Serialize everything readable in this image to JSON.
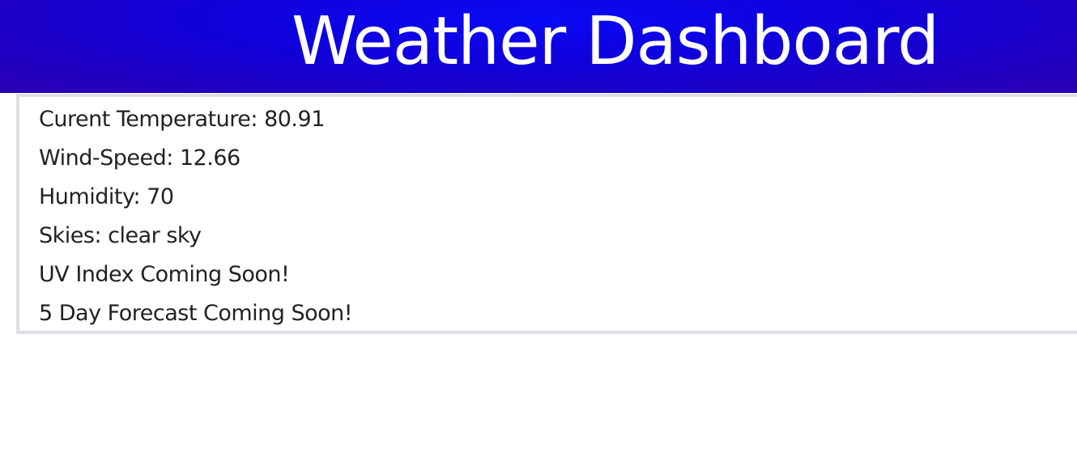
{
  "header": {
    "title": "Weather Dashboard"
  },
  "weather": {
    "items": [
      "Curent Temperature: 80.91",
      "Wind-Speed: 12.66",
      "Humidity: 70",
      "Skies: clear sky",
      "UV Index Coming Soon!",
      "5 Day Forecast Coming Soon!"
    ]
  },
  "colors": {
    "header_bg": "#1000d8",
    "header_text": "#ffffff",
    "panel_border": "#dfe0e5",
    "body_text": "#222222"
  }
}
